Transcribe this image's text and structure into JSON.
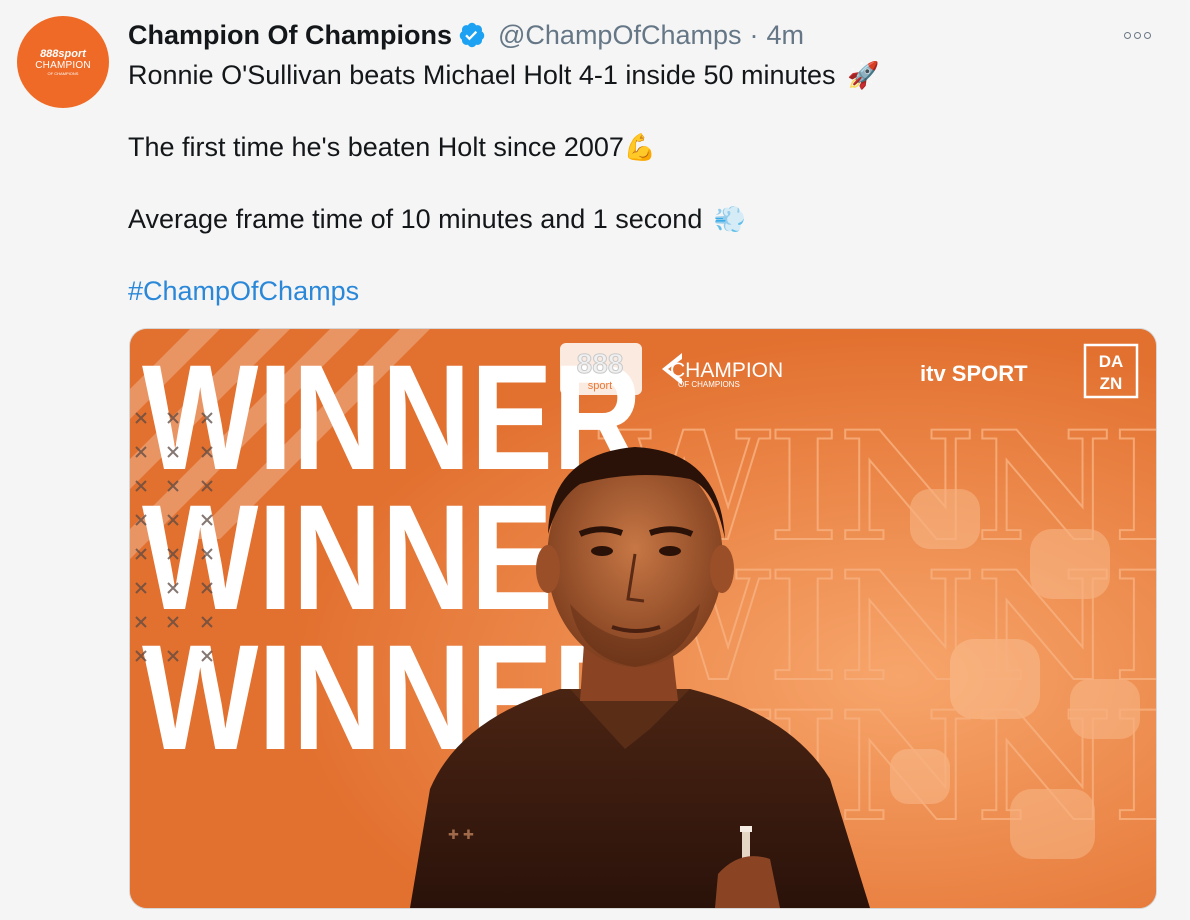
{
  "tweet": {
    "avatar": {
      "brand": "888sport",
      "name": "CHAMPION",
      "sub": "OF CHAMPIONS"
    },
    "display_name": "Champion Of Champions",
    "handle": "@ChampOfChamps",
    "separator": "·",
    "time": "4m",
    "lines": [
      {
        "text": "Ronnie O'Sullivan beats Michael Holt 4-1 inside 50 minutes",
        "emoji": "🚀"
      },
      {
        "text": "The first time he's beaten Holt since 2007",
        "emoji": "💪"
      },
      {
        "text": "Average frame time of 10 minutes and 1 second",
        "emoji": "💨"
      }
    ],
    "hashtag": "#ChampOfChamps"
  },
  "media": {
    "big_word": "WINNER",
    "logo_888": "888",
    "logo_888_sub": "sport",
    "logo_title": "CHAMPION",
    "logo_subtitle": "OF CHAMPIONS",
    "broadcaster": "itv SPORT",
    "dazn_top": "DA",
    "dazn_bottom": "ZN",
    "colors": {
      "bg": "#e87a3a",
      "dark": "#3a1c0e",
      "text": "#ffffff"
    }
  }
}
